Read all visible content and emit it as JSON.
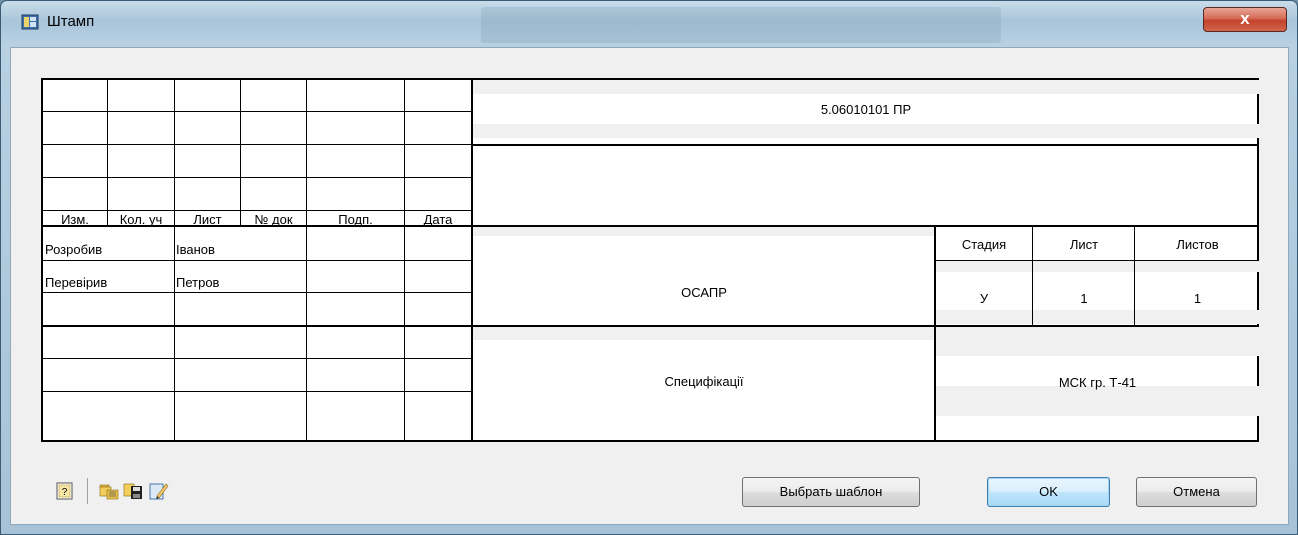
{
  "window": {
    "title": "Штамп",
    "close_glyph": "x",
    "title_icon": "stamp-app-icon"
  },
  "stamp": {
    "designation": "5.06010101 ПР",
    "header_labels": [
      "Изм.",
      "Кол. уч",
      "Лист",
      "№ док",
      "Подп.",
      "Дата"
    ],
    "roles": [
      {
        "role": "Розробив",
        "name": "Іванов"
      },
      {
        "role": "Перевірив",
        "name": "Петров"
      }
    ],
    "product_name": "ОСАПР",
    "stage_headers": [
      "Стадия",
      "Лист",
      "Листов"
    ],
    "stage_values": [
      "У",
      "1",
      "1"
    ],
    "document_name": "Специфікації",
    "organization": "МСК гр. Т-41"
  },
  "footer": {
    "icons": [
      "help-icon",
      "open-folder-icon",
      "save-icon",
      "edit-icon"
    ],
    "choose_template_label": "Выбрать шаблон",
    "ok_label": "OK",
    "cancel_label": "Отмена"
  }
}
